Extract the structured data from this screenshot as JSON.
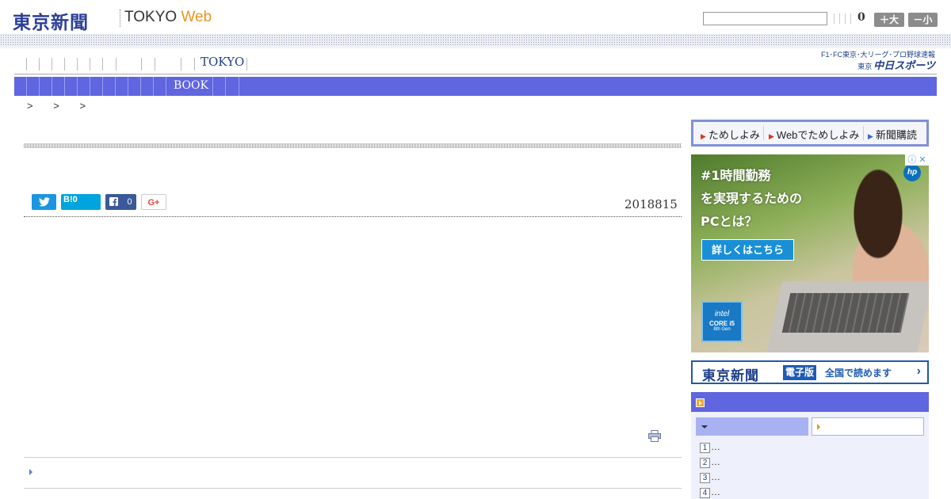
{
  "header": {
    "logo_text": "東京新聞",
    "sub_logo_text": "TOKYO",
    "sub_logo_accent": "Web",
    "font_size_value": "0",
    "font_large_label": "＋大",
    "font_small_label": "－小"
  },
  "nav": {
    "top_tokyo": "TOKYO",
    "bar_book": "BOOK",
    "sports_line1": "F1･FC東京･大リーグ･プロ野球速報",
    "sports_line2_prefix": "東京",
    "sports_line2": "中日スポーツ"
  },
  "breadcrumb": [
    ">",
    ">",
    ">"
  ],
  "article": {
    "date": "2018815",
    "share": {
      "hatena_label": "B!",
      "hatena_count": "0",
      "facebook_count": "0",
      "gplus_label": "G+"
    }
  },
  "sidebar": {
    "subscribe": [
      {
        "label": "ためしよみ"
      },
      {
        "label": "Webでためしよみ"
      },
      {
        "label": "新聞購読"
      }
    ],
    "ad": {
      "line1": "#1時間勤務",
      "line2": "を実現するための",
      "line3": "PCとは？",
      "cta": "詳しくはこちら",
      "badge_line1": "intel",
      "badge_line2": "CORE i5",
      "badge_line3": "8th Gen",
      "brand": "hp",
      "close": "ⓘ ✕"
    },
    "edition_banner": {
      "logo": "東京新聞",
      "tag": "電子版",
      "text": "全国で読めます",
      "arrow": "›"
    },
    "ranking": {
      "items": [
        {
          "num": "1",
          "text": "…"
        },
        {
          "num": "2",
          "text": "…"
        },
        {
          "num": "3",
          "text": "…"
        },
        {
          "num": "4",
          "text": "…"
        }
      ]
    }
  },
  "colors": {
    "nav_bar": "#6065e0",
    "logo": "#2b3e99",
    "accent_orange": "#e8961e"
  }
}
